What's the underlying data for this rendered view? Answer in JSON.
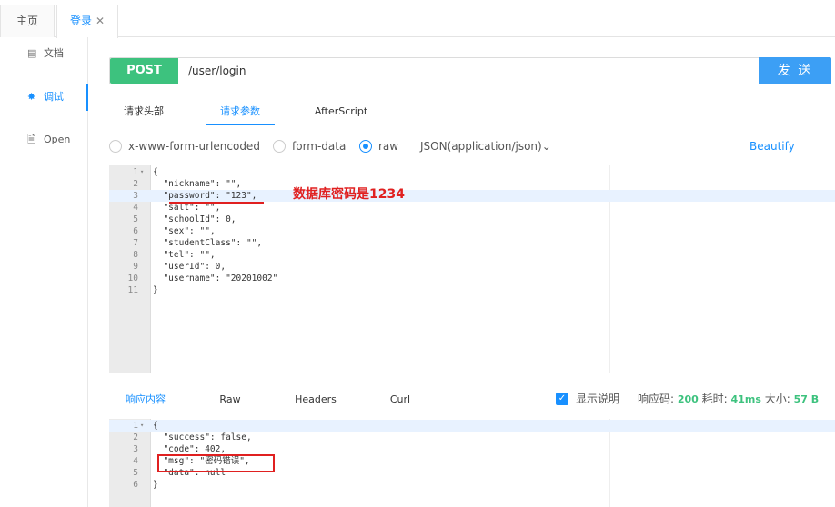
{
  "tabs": {
    "home": "主页",
    "login": "登录",
    "close": "✕"
  },
  "sidebar": {
    "items": [
      {
        "icon": "document-icon",
        "glyph": "▤",
        "label": "文档"
      },
      {
        "icon": "bug-icon",
        "glyph": "✸",
        "label": "调试"
      },
      {
        "icon": "file-icon",
        "glyph": "🗎",
        "label": "Open"
      }
    ]
  },
  "request": {
    "method": "POST",
    "url": "/user/login",
    "send": "发 送"
  },
  "param_tabs": [
    "请求头部",
    "请求参数",
    "AfterScript"
  ],
  "body_types": {
    "options": [
      "x-www-form-urlencoded",
      "form-data",
      "raw"
    ],
    "selected": "raw",
    "content_type": "JSON(application/json)",
    "chevron": "⌄",
    "beautify": "Beautify"
  },
  "request_body": [
    {
      "n": "1",
      "fold": "▾",
      "text": "{"
    },
    {
      "n": "2",
      "text": "  \"nickname\": \"\","
    },
    {
      "n": "3",
      "text": "  \"password\": \"123\","
    },
    {
      "n": "4",
      "text": "  \"salt\": \"\","
    },
    {
      "n": "5",
      "text": "  \"schoolId\": 0,"
    },
    {
      "n": "6",
      "text": "  \"sex\": \"\","
    },
    {
      "n": "7",
      "text": "  \"studentClass\": \"\","
    },
    {
      "n": "8",
      "text": "  \"tel\": \"\","
    },
    {
      "n": "9",
      "text": "  \"userId\": 0,"
    },
    {
      "n": "10",
      "text": "  \"username\": \"20201002\""
    },
    {
      "n": "11",
      "text": "}"
    }
  ],
  "annotation": "数据库密码是1234",
  "response_tabs": [
    "响应内容",
    "Raw",
    "Headers",
    "Curl"
  ],
  "response_meta": {
    "show_desc": "显示说明",
    "status_label": "响应码:",
    "status_value": "200",
    "time_label": "耗时:",
    "time_value": "41ms",
    "size_label": "大小:",
    "size_value": "57 B",
    "check": "✓"
  },
  "response_body": [
    {
      "n": "1",
      "fold": "▾",
      "text": "{"
    },
    {
      "n": "2",
      "text": "  \"success\": false,"
    },
    {
      "n": "3",
      "text": "  \"code\": 402,"
    },
    {
      "n": "4",
      "text": "  \"msg\": \"密码错误\","
    },
    {
      "n": "5",
      "text": "  \"data\": null"
    },
    {
      "n": "6",
      "text": "}"
    }
  ],
  "colors": {
    "accent": "#1890ff",
    "post": "#3dc27e",
    "send": "#3c9ff5",
    "annotation": "#e02020"
  }
}
